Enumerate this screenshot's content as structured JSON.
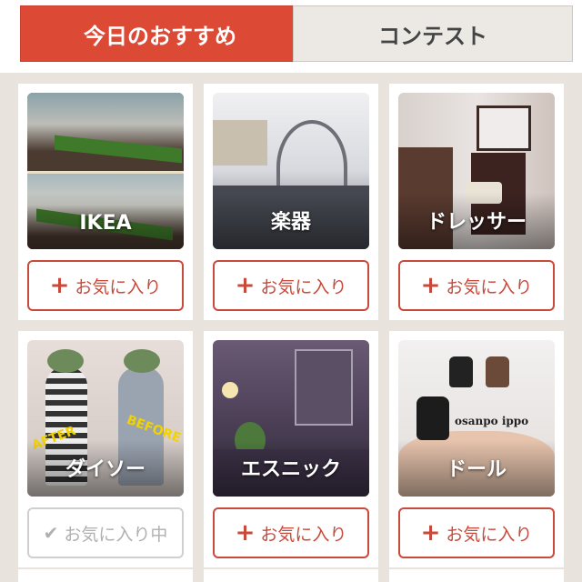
{
  "tabs": [
    {
      "label": "今日のおすすめ",
      "active": true
    },
    {
      "label": "コンテスト",
      "active": false
    }
  ],
  "cards": [
    {
      "label": "IKEA",
      "fav_label": "お気に入り",
      "favorited": false
    },
    {
      "label": "楽器",
      "fav_label": "お気に入り",
      "favorited": false
    },
    {
      "label": "ドレッサー",
      "fav_label": "お気に入り",
      "favorited": false
    },
    {
      "label": "ダイソー",
      "fav_label": "お気に入り中",
      "favorited": true,
      "photo_text": {
        "after": "AFTER",
        "before": "BEFORE"
      }
    },
    {
      "label": "エスニック",
      "fav_label": "お気に入り",
      "favorited": false
    },
    {
      "label": "ドール",
      "fav_label": "お気に入り",
      "favorited": false,
      "photo_text": {
        "brand": "osanpo ippo"
      }
    }
  ],
  "icons": {
    "add": "plus-icon",
    "added": "check-icon"
  },
  "colors": {
    "accent": "#dc4a36",
    "button_border": "#c84a3a",
    "background": "#e8e3dd"
  }
}
